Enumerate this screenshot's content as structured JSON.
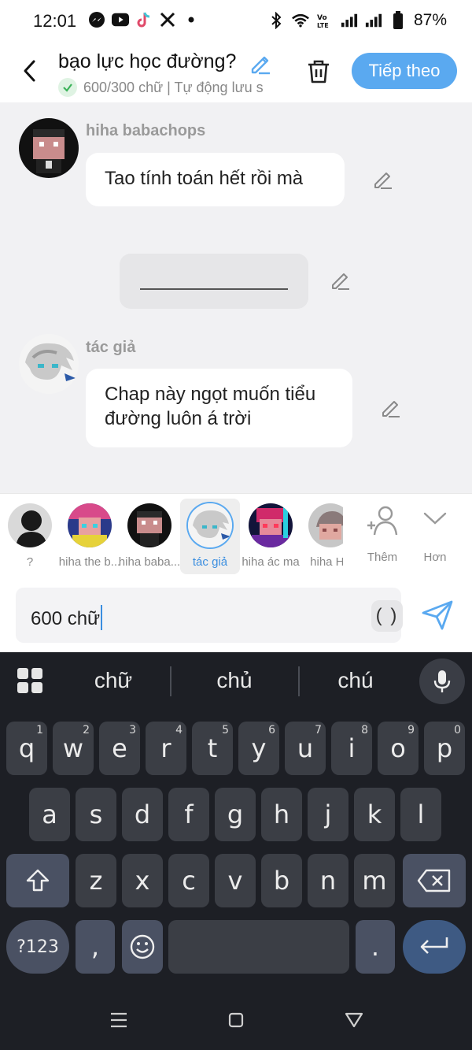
{
  "status_bar": {
    "time": "12:01",
    "battery": "87%",
    "left_icons": [
      "messenger-icon",
      "youtube-icon",
      "tiktok-icon",
      "x-icon",
      "dot-icon"
    ],
    "right_icons": [
      "bluetooth-icon",
      "wifi-icon",
      "volte-icon",
      "signal-icon",
      "signal-icon",
      "battery-icon"
    ]
  },
  "header": {
    "title": "bạo lực học đường?",
    "subtitle": "600/300 chữ | Tự động lưu s",
    "next_label": "Tiếp theo"
  },
  "messages": [
    {
      "author": "hiha babachops",
      "text": "Tao tính toán hết rồi mà"
    },
    {
      "type": "narration",
      "text": ""
    },
    {
      "author": "tác giả",
      "text": "Chap này ngọt muốn tiểu đường luôn á trời"
    }
  ],
  "characters": [
    {
      "label": "?"
    },
    {
      "label": "hiha the b..."
    },
    {
      "label": "hiha baba..."
    },
    {
      "label": "tác giả",
      "selected": true
    },
    {
      "label": "hiha ác ma"
    },
    {
      "label": "hiha He"
    }
  ],
  "strip_actions": {
    "add_label": "Thêm",
    "more_label": "Hơn"
  },
  "input": {
    "value": "600 chữ",
    "paren_label": "( )"
  },
  "keyboard": {
    "suggestions": [
      "chữ",
      "chủ",
      "chú"
    ],
    "row1": [
      {
        "k": "q",
        "h": "1"
      },
      {
        "k": "w",
        "h": "2"
      },
      {
        "k": "e",
        "h": "3"
      },
      {
        "k": "r",
        "h": "4"
      },
      {
        "k": "t",
        "h": "5"
      },
      {
        "k": "y",
        "h": "6"
      },
      {
        "k": "u",
        "h": "7"
      },
      {
        "k": "i",
        "h": "8"
      },
      {
        "k": "o",
        "h": "9"
      },
      {
        "k": "p",
        "h": "0"
      }
    ],
    "row2": [
      "a",
      "s",
      "d",
      "f",
      "g",
      "h",
      "j",
      "k",
      "l"
    ],
    "row3": [
      "z",
      "x",
      "c",
      "v",
      "b",
      "n",
      "m"
    ],
    "sym_label": "?123",
    "comma": ",",
    "period": "."
  },
  "colors": {
    "accent": "#5aa9f0",
    "keyboard_bg": "#1d1f25",
    "key_bg": "#3b3e45"
  }
}
